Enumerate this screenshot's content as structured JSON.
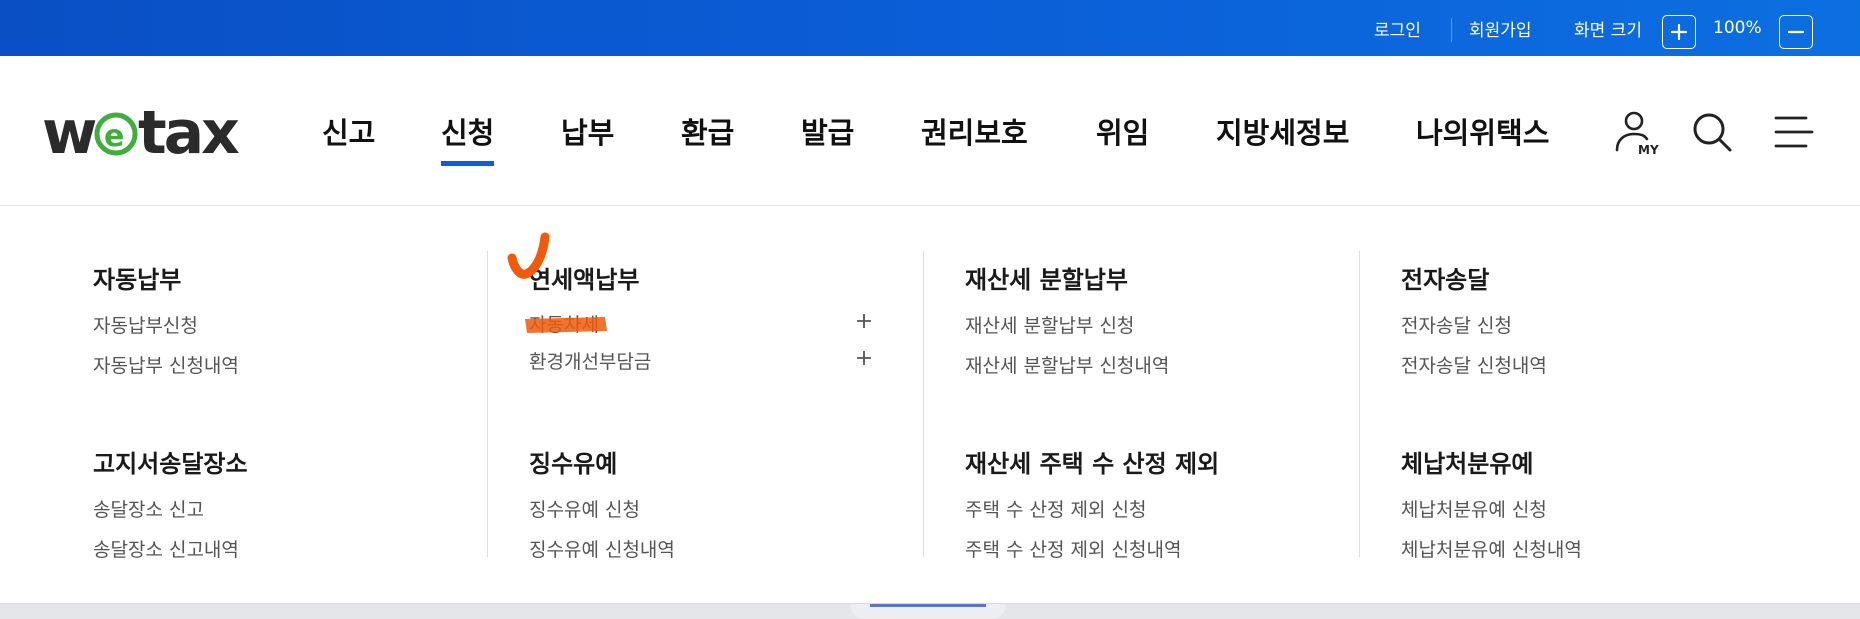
{
  "topbar": {
    "login": "로그인",
    "join": "회원가입",
    "zoom_label": "화면 크기",
    "zoom_value": "100%"
  },
  "logo": {
    "text": "wetax"
  },
  "nav": {
    "items": [
      "신고",
      "신청",
      "납부",
      "환급",
      "발급",
      "권리보호",
      "위임",
      "지방세정보",
      "나의위택스"
    ],
    "active": "신청",
    "my_label": "MY"
  },
  "menu": {
    "groups": [
      {
        "title": "자동납부",
        "items": [
          "자동납부신청",
          "자동납부 신청내역"
        ]
      },
      {
        "title": "연세액납부",
        "items": [
          "자동차세",
          "환경개선부담금"
        ]
      },
      {
        "title": "재산세 분할납부",
        "items": [
          "재산세 분할납부 신청",
          "재산세 분할납부 신청내역"
        ]
      },
      {
        "title": "전자송달",
        "items": [
          "전자송달 신청",
          "전자송달 신청내역"
        ]
      },
      {
        "title": "고지서송달장소",
        "items": [
          "송달장소 신고",
          "송달장소 신고내역"
        ]
      },
      {
        "title": "징수유예",
        "items": [
          "징수유예 신청",
          "징수유예 신청내역"
        ]
      },
      {
        "title": "재산세 주택 수 산정 제외",
        "items": [
          "주택 수 산정 제외 신청",
          "주택 수 산정 제외 신청내역"
        ]
      },
      {
        "title": "체납처분유예",
        "items": [
          "체납처분유예 신청",
          "체납처분유예 신청내역"
        ]
      }
    ]
  },
  "colors": {
    "brand_blue": "#0b5ed7",
    "logo_green": "#3fae3a",
    "annotation": "#f05a0a"
  }
}
